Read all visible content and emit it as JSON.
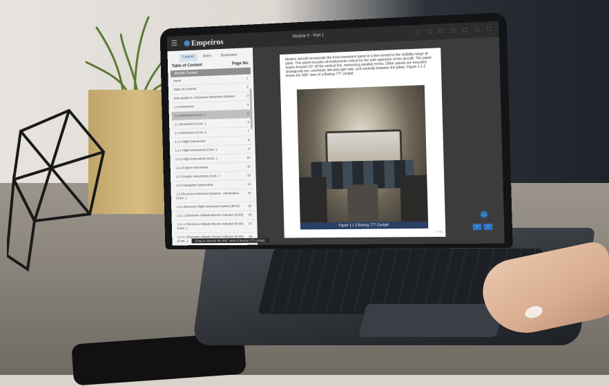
{
  "app": {
    "logo_text": "Empeiros",
    "module_title": "Module 5 - Part 1",
    "tools_text": "⬚ ⬚ ⬚ ⬚ ⬚ ⬚ ⬚"
  },
  "sidebar": {
    "tabs": [
      "Content",
      "Notes",
      "Bookmarks"
    ],
    "toc_title": "Table of Content",
    "page_no_label": "Page No.",
    "module_label": "Module Content",
    "items": [
      {
        "label": "Home",
        "page": "1"
      },
      {
        "label": "Table of Contents",
        "page": "2"
      },
      {
        "label": "Sub-module 5.1 Electronic Instrument Systems",
        "page": "3"
      },
      {
        "label": "1.1 Introduction",
        "page": "4"
      },
      {
        "label": "1.1 Introduction (Cont...)",
        "page": "5"
      },
      {
        "label": "1.1 Introduction (Cont...)",
        "page": "6"
      },
      {
        "label": "1.1 Introduction (Cont...)",
        "page": "7"
      },
      {
        "label": "1.2.1 Flight Instruments",
        "page": "8"
      },
      {
        "label": "1.2.1 Flight Instruments (Cont...)",
        "page": "9"
      },
      {
        "label": "1.2.1 Flight Instruments (Cont...)",
        "page": "10"
      },
      {
        "label": "1.2.2 Engine Instruments",
        "page": "11"
      },
      {
        "label": "1.2.2 Engine Instruments (Cont...)",
        "page": "12"
      },
      {
        "label": "1.2.3 Navigation Instruments",
        "page": "13"
      },
      {
        "label": "1.3 Electronic Instrument Systems - Introduction (Cont...)",
        "page": "14"
      },
      {
        "label": "1.3.1 Electronic Flight Instrument System (EFIS)",
        "page": "15"
      },
      {
        "label": "1.3.1.1 Electronic Attitude Director Indicator (EADI)",
        "page": "16"
      },
      {
        "label": "1.3.1.1 Electronic Attitude Director Indicator (EADI) (Cont...)",
        "page": "17"
      },
      {
        "label": "1.3.1.1 Electronic Attitude Director Indicator (EADI) (Cont...)",
        "page": "18"
      }
    ]
  },
  "page": {
    "body": "Modern aircraft incorporate the front instrument panel in a line normal to the visibility range of pilots. This panel includes all instruments critical for the safe operation of the aircraft. The panel slopes forward 10° off the vertical line, minimising parallax errors. Other panels are mounted strategically too: overhead, left-and-right side, and centrally between the pilots. Figure 1.1-2 shows the 360° view of a Boeing 777 cockpit.",
    "caption": "Figure 1.1-2 Boeing 777 Cockpit",
    "page_indicator": "7 / 61",
    "hint": "Drag to observe the 360° view of Boeing 777 cockpit."
  },
  "nav": {
    "prev": "‹",
    "next": "›",
    "chat": "…"
  }
}
